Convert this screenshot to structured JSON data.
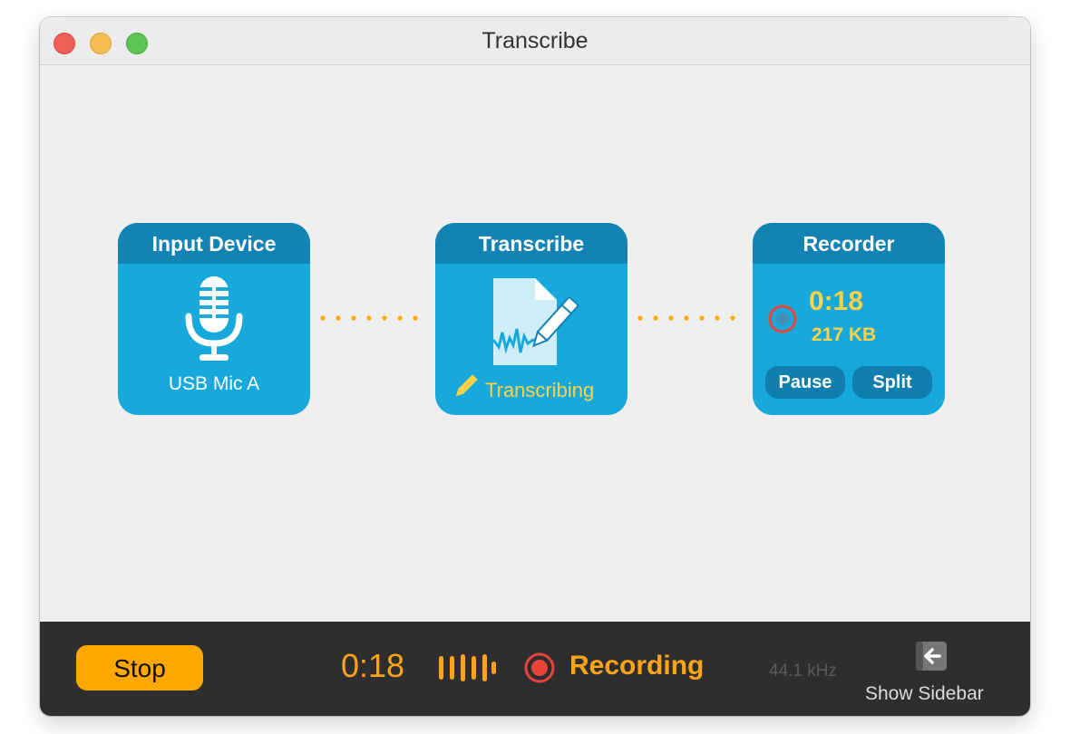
{
  "window": {
    "title": "Transcribe"
  },
  "nodes": {
    "input": {
      "title": "Input Device",
      "device": "USB Mic A",
      "icon": "microphone-icon"
    },
    "transcribe": {
      "title": "Transcribe",
      "status": "Transcribing",
      "icon": "document-pencil-icon"
    },
    "recorder": {
      "title": "Recorder",
      "time": "0:18",
      "size": "217 KB",
      "pause_label": "Pause",
      "split_label": "Split"
    }
  },
  "bottom_bar": {
    "stop_label": "Stop",
    "time": "0:18",
    "status": "Recording",
    "sample_rate": "44.1 kHz",
    "sidebar_label": "Show Sidebar"
  },
  "colors": {
    "accent": "#fea800",
    "node_blue": "#17a8dc",
    "node_header": "#1383b3",
    "recording_red": "#e8443a",
    "highlight_yellow": "#ffd24a"
  }
}
